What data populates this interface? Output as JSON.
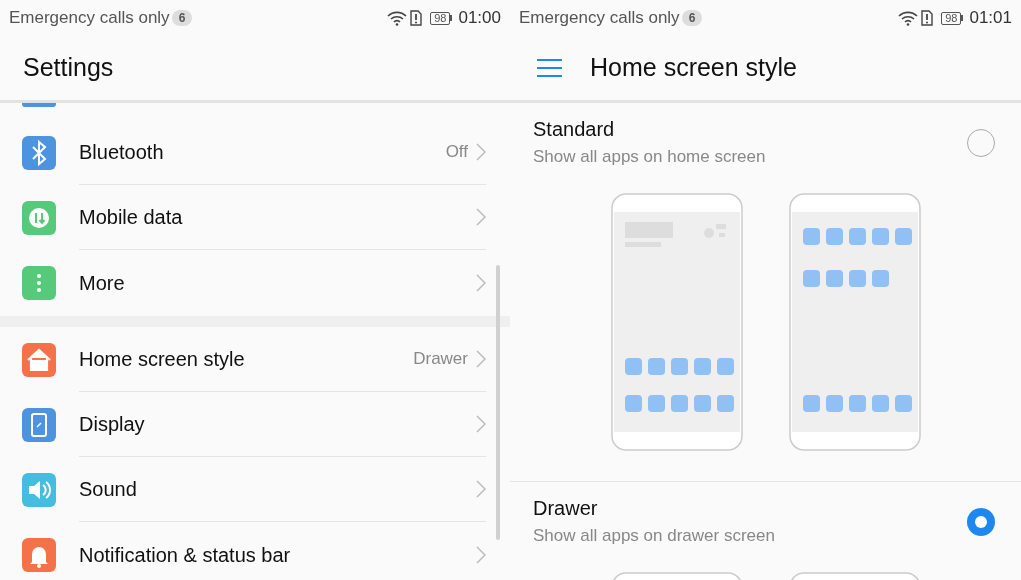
{
  "panels": [
    {
      "status_bar": {
        "carrier": "Emergency calls only",
        "badge": "6",
        "battery": "98",
        "time": "01:00"
      },
      "settings": {
        "title": "Settings",
        "sections": [
          {
            "items": [
              {
                "kind": "bluetooth",
                "label": "Bluetooth",
                "value": "Off"
              },
              {
                "kind": "mobile-data",
                "label": "Mobile data"
              },
              {
                "kind": "more",
                "label": "More"
              }
            ]
          },
          {
            "items": [
              {
                "kind": "home",
                "label": "Home screen style",
                "value": "Drawer"
              },
              {
                "kind": "display",
                "label": "Display"
              },
              {
                "kind": "sound",
                "label": "Sound"
              },
              {
                "kind": "notification",
                "label": "Notification & status bar"
              }
            ]
          }
        ]
      }
    },
    {
      "status_bar": {
        "carrier": "Emergency calls only",
        "badge": "6",
        "battery": "98",
        "time": "01:01"
      },
      "home_screen_style": {
        "title": "Home screen style",
        "options": [
          {
            "kind": "standard",
            "title": "Standard",
            "subtitle": "Show all apps on home screen",
            "selected": false
          },
          {
            "kind": "drawer",
            "title": "Drawer",
            "subtitle": "Show all apps on drawer screen",
            "selected": true
          }
        ]
      }
    }
  ]
}
